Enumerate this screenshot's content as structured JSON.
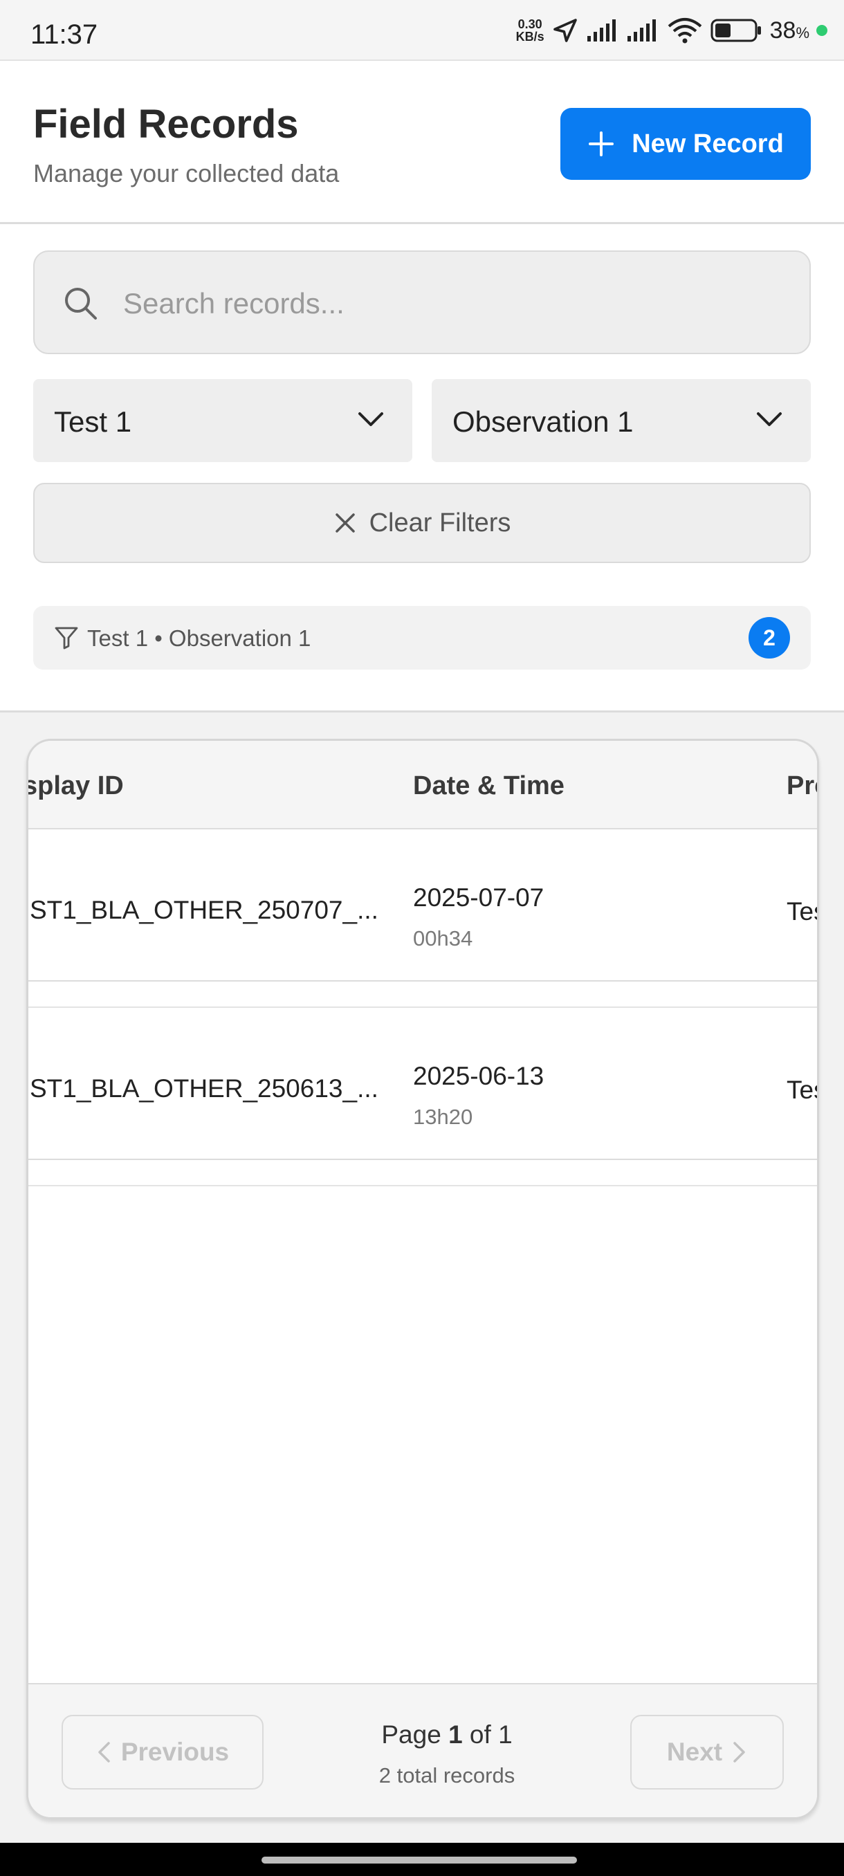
{
  "status_bar": {
    "time": "11:37",
    "net_speed_value": "0.30",
    "net_speed_unit": "KB/s",
    "battery_percent": "38",
    "battery_suffix": "%",
    "icons": [
      "location-arrow-icon",
      "signal-icon",
      "signal-icon",
      "wifi-icon",
      "battery-icon"
    ]
  },
  "header": {
    "title": "Field Records",
    "subtitle": "Manage your collected data",
    "new_record_label": "New Record",
    "accent_color": "#0a7cf2"
  },
  "filters": {
    "search_placeholder": "Search records...",
    "search_value": "",
    "test_select_value": "Test 1",
    "observation_select_value": "Observation 1",
    "clear_filters_label": "Clear Filters",
    "active_filter_text": "Test 1 • Observation 1",
    "active_filter_count": "2"
  },
  "table": {
    "columns": [
      "splay ID",
      "Date & Time",
      "Pro"
    ],
    "rows": [
      {
        "display_id": "ST1_BLA_OTHER_250707_...",
        "date": "2025-07-07",
        "time": "00h34",
        "project": "Tes"
      },
      {
        "display_id": "ST1_BLA_OTHER_250613_...",
        "date": "2025-06-13",
        "time": "13h20",
        "project": "Tes"
      }
    ]
  },
  "pagination": {
    "previous_label": "Previous",
    "next_label": "Next",
    "page_prefix": "Page",
    "current_page": "1",
    "page_of": "of",
    "total_pages": "1",
    "total_records_text": "2 total records"
  }
}
